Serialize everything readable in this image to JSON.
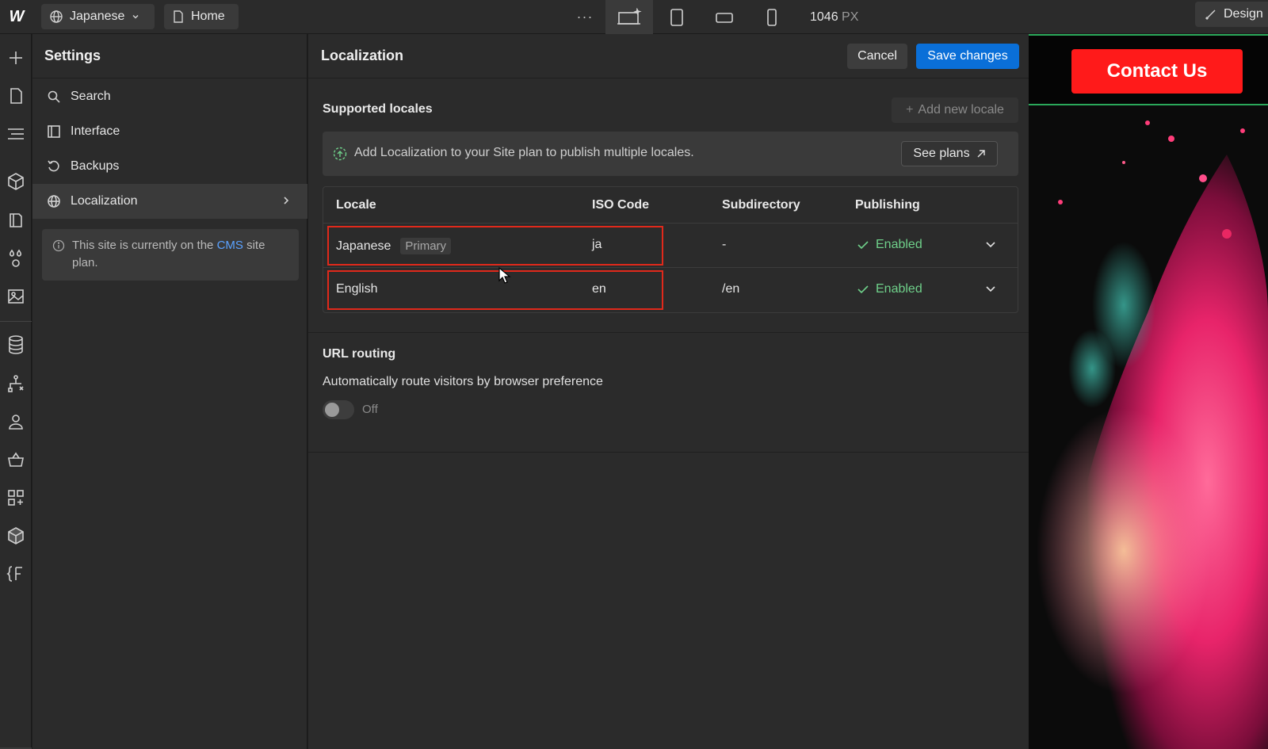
{
  "topbar": {
    "logo": "W",
    "locale_label": "Japanese",
    "page_label": "Home",
    "more": "···",
    "width_value": "1046",
    "width_unit": "PX",
    "design_label": "Design"
  },
  "settings": {
    "title": "Settings",
    "items": [
      {
        "label": "Search",
        "icon": "search-icon"
      },
      {
        "label": "Interface",
        "icon": "sidebar-icon"
      },
      {
        "label": "Backups",
        "icon": "history-icon"
      },
      {
        "label": "Localization",
        "icon": "globe-icon"
      }
    ],
    "plan_note_prefix": "This site is currently on the",
    "plan_note_link": "CMS",
    "plan_note_suffix": "site plan."
  },
  "localization": {
    "title": "Localization",
    "cancel_label": "Cancel",
    "save_label": "Save changes",
    "supported_title": "Supported locales",
    "add_locale_label": "Add new locale",
    "banner_text": "Add Localization to your Site plan to publish multiple locales.",
    "see_plans_label": "See plans",
    "columns": [
      "Locale",
      "ISO Code",
      "Subdirectory",
      "Publishing"
    ],
    "rows": [
      {
        "locale": "Japanese",
        "tag": "Primary",
        "iso": "ja",
        "subdir": "-",
        "publishing": "Enabled"
      },
      {
        "locale": "English",
        "tag": "",
        "iso": "en",
        "subdir": "/en",
        "publishing": "Enabled"
      }
    ],
    "routing_title": "URL routing",
    "routing_desc": "Automatically route visitors by browser preference",
    "routing_state": "Off"
  },
  "preview": {
    "contact_label": "Contact Us"
  },
  "colors": {
    "accent": "#0a6fd8",
    "enabled": "#6fd08a",
    "highlight": "#e0291b",
    "contact": "#ff1a1a"
  }
}
